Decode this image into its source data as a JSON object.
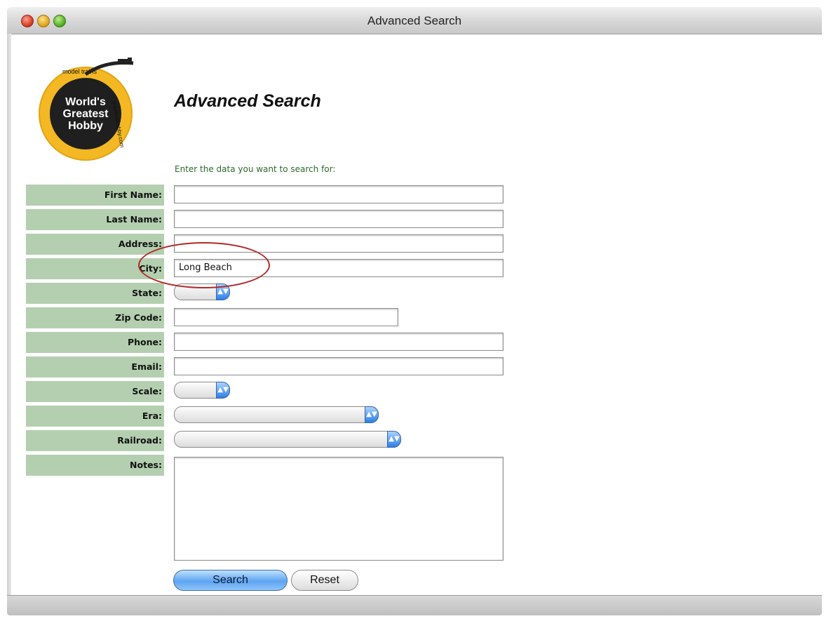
{
  "window": {
    "title": "Advanced Search"
  },
  "logo": {
    "line1": "World's",
    "line2": "Greatest",
    "line3": "Hobby",
    "arc_top": "model trains",
    "arc_right": "greatesthobby.com"
  },
  "page": {
    "title": "Advanced Search",
    "instruction": "Enter the data you want to search for:"
  },
  "form": {
    "fields": [
      {
        "label": "First Name:",
        "value": ""
      },
      {
        "label": "Last Name:",
        "value": ""
      },
      {
        "label": "Address:",
        "value": ""
      },
      {
        "label": "City:",
        "value": "Long Beach"
      },
      {
        "label": "State:",
        "value": ""
      },
      {
        "label": "Zip Code:",
        "value": ""
      },
      {
        "label": "Phone:",
        "value": ""
      },
      {
        "label": "Email:",
        "value": ""
      },
      {
        "label": "Scale:",
        "value": ""
      },
      {
        "label": "Era:",
        "value": ""
      },
      {
        "label": "Railroad:",
        "value": ""
      },
      {
        "label": "Notes:",
        "value": ""
      }
    ]
  },
  "buttons": {
    "search": "Search",
    "reset": "Reset"
  },
  "colors": {
    "label_bg": "#b3cfaf",
    "instruction_text": "#2a6a2a",
    "highlight": "#b22a2a",
    "accent_blue": "#5ea4f1"
  }
}
